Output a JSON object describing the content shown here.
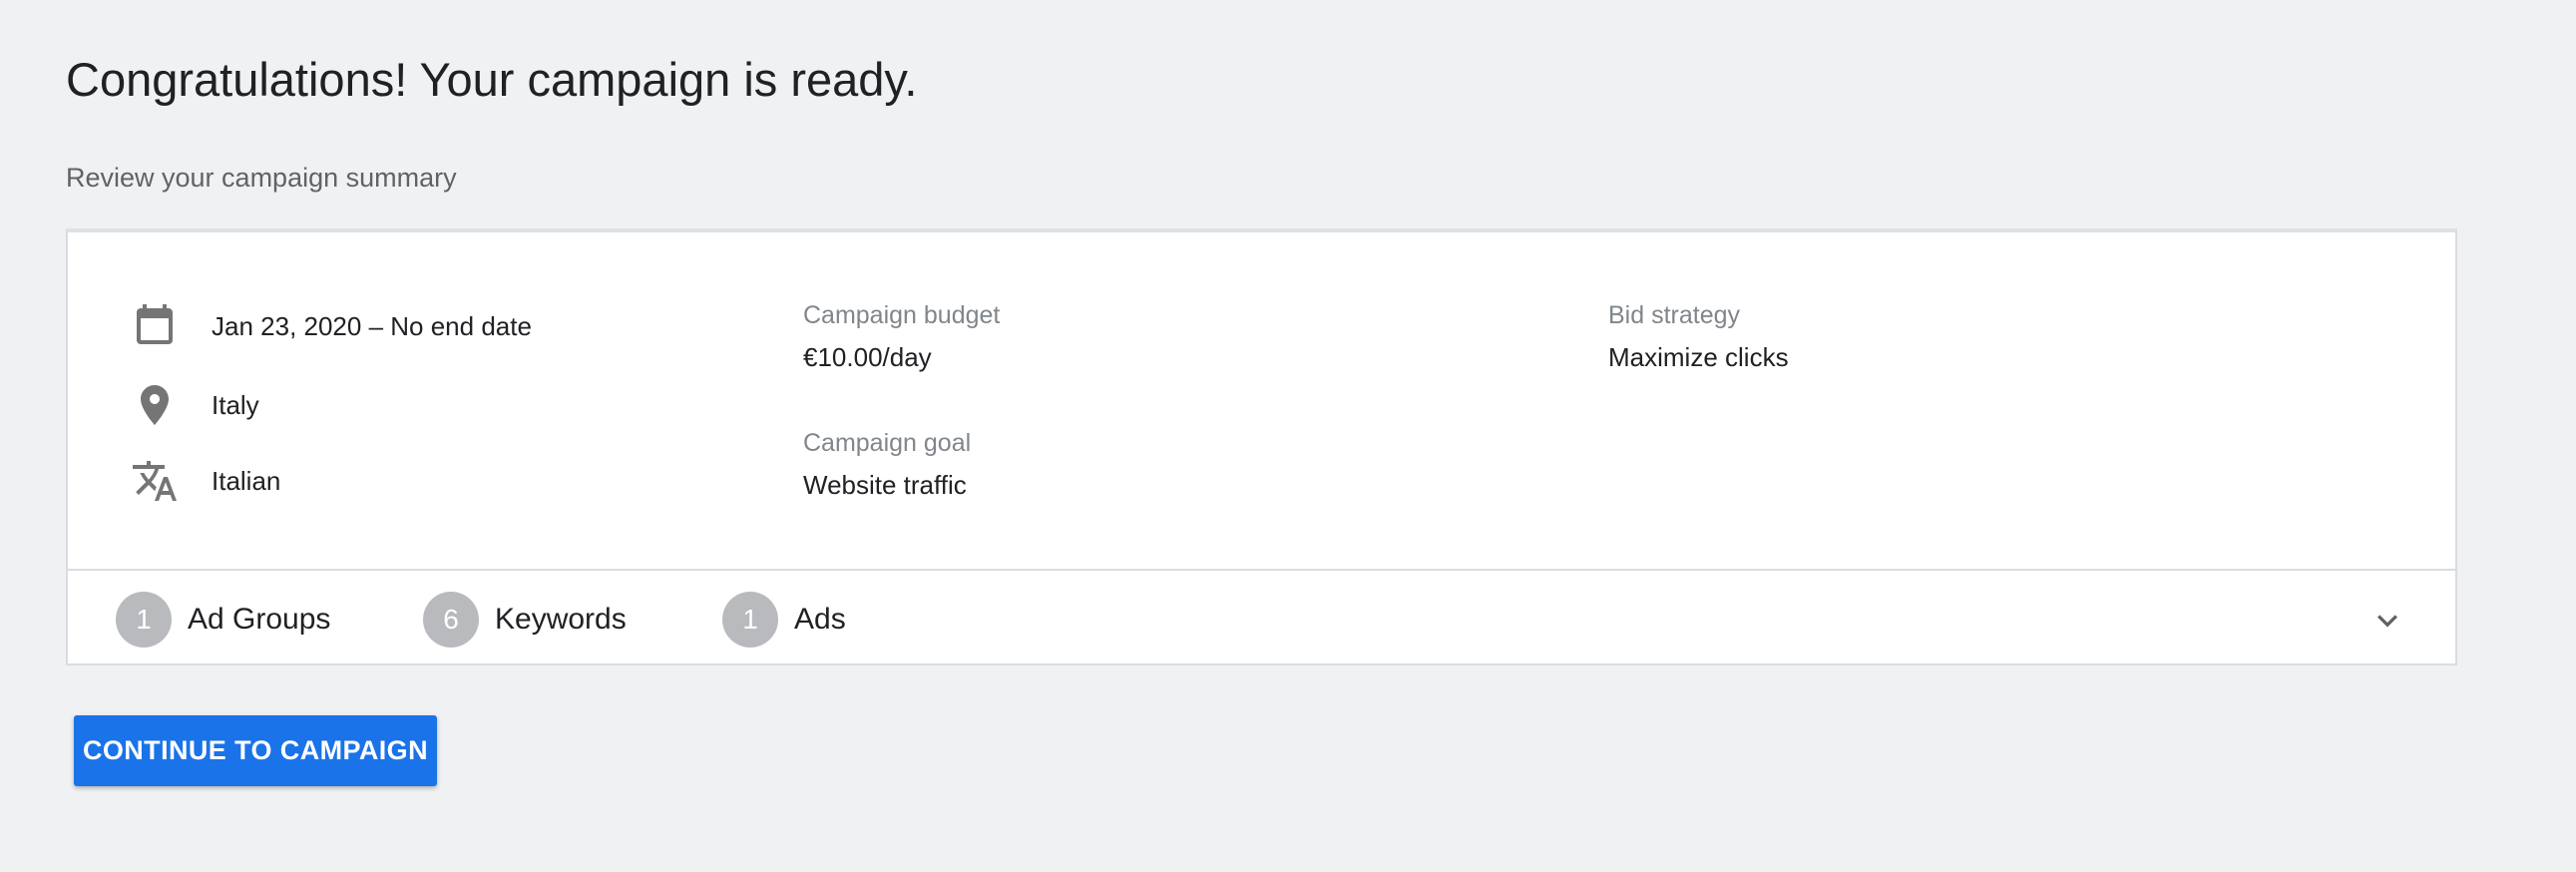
{
  "header": {
    "title": "Congratulations! Your campaign is ready.",
    "subtitle": "Review your campaign summary"
  },
  "summary": {
    "details": [
      {
        "icon": "calendar-icon",
        "label": "Jan 23, 2020 – No end date"
      },
      {
        "icon": "location-pin-icon",
        "label": "Italy"
      },
      {
        "icon": "translate-icon",
        "label": "Italian"
      }
    ],
    "budget": {
      "label": "Campaign budget",
      "value": "€10.00/day"
    },
    "goal": {
      "label": "Campaign goal",
      "value": "Website traffic"
    },
    "bid_strategy": {
      "label": "Bid strategy",
      "value": "Maximize clicks"
    }
  },
  "counts": [
    {
      "count": "1",
      "label": "Ad Groups"
    },
    {
      "count": "6",
      "label": "Keywords"
    },
    {
      "count": "1",
      "label": "Ads"
    }
  ],
  "expand_icon": "chevron-down-icon",
  "actions": {
    "continue_label": "CONTINUE TO CAMPAIGN"
  },
  "colors": {
    "background": "#f0f1f3",
    "primary": "#1a73e8",
    "badge": "#b8babd",
    "icon": "#757575"
  }
}
